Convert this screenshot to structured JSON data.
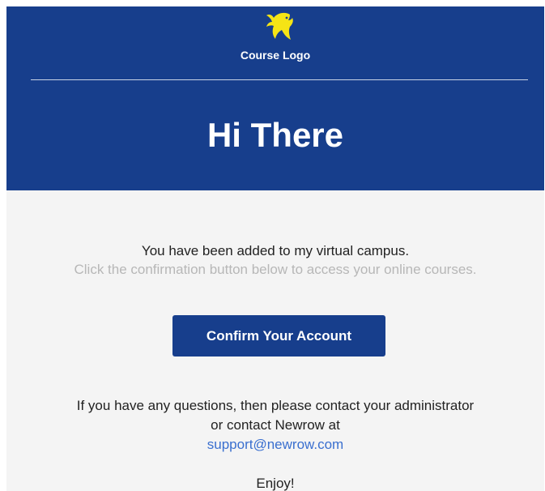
{
  "header": {
    "logo_icon": "bird-logo-icon",
    "logo_text": "Course Logo",
    "title": "Hi There"
  },
  "body": {
    "message_primary": "You have been added to my virtual campus.",
    "message_secondary": "Click the confirmation button below to access your online courses.",
    "confirm_button_label": "Confirm Your Account",
    "help_line_1": "If you have any questions, then please contact your administrator",
    "help_line_2": "or contact Newrow at",
    "support_email": "support@newrow.com",
    "closing": "Enjoy!"
  },
  "colors": {
    "brand": "#173e8c",
    "logo": "#f5e415",
    "background": "#f4f4f4",
    "link": "#3a6fcf",
    "muted_text": "#b7b7b7"
  }
}
